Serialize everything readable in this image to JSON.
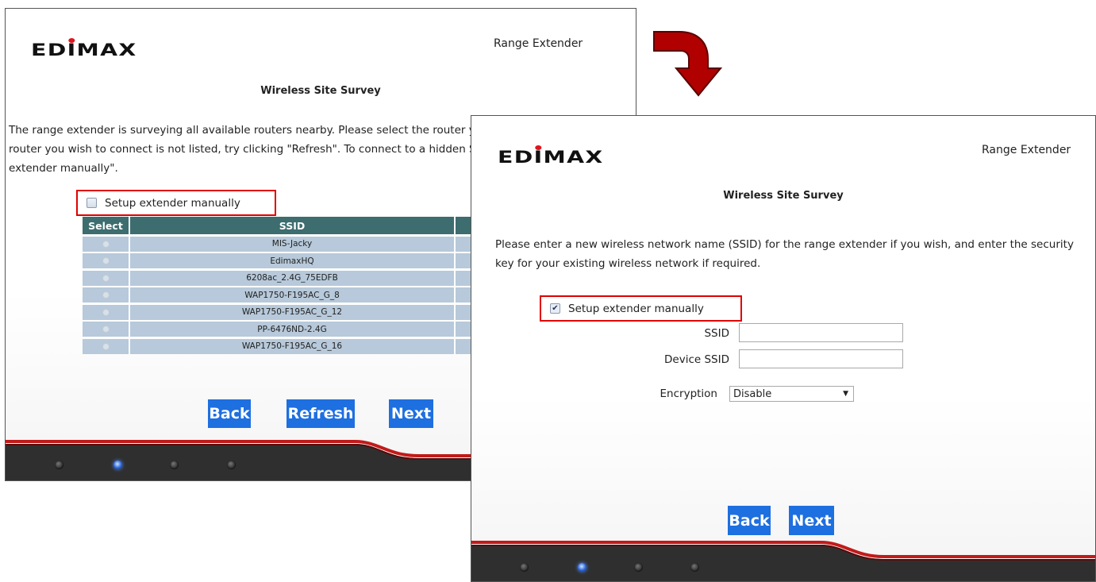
{
  "brand": {
    "logo": "EDIMAX",
    "product": "Range Extender"
  },
  "screen1": {
    "heading": "Wireless Site Survey",
    "intro_lines": [
      "The range extender is surveying all available routers nearby. Please select the router you",
      "router you wish to connect is not listed, try clicking \"Refresh\". To connect to a hidden SSI",
      "extender manually\"."
    ],
    "manual_label": "Setup extender manually",
    "manual_checked": false,
    "table": {
      "headers": [
        "Select",
        "SSID"
      ],
      "rows": [
        "MIS-Jacky",
        "EdimaxHQ",
        "6208ac_2.4G_75EDFB",
        "WAP1750-F195AC_G_8",
        "WAP1750-F195AC_G_12",
        "PP-6476ND-2.4G",
        "WAP1750-F195AC_G_16"
      ]
    },
    "buttons": {
      "back": "Back",
      "refresh": "Refresh",
      "next": "Next"
    }
  },
  "screen2": {
    "heading": "Wireless Site Survey",
    "intro_lines": [
      "Please enter a new wireless network name (SSID) for the range extender if you wish, and enter the security",
      "key for your existing wireless network if required."
    ],
    "manual_label": "Setup extender manually",
    "manual_checked": true,
    "fields": {
      "ssid_label": "SSID",
      "ssid_value": "",
      "device_ssid_label": "Device SSID",
      "device_ssid_value": "",
      "encryption_label": "Encryption",
      "encryption_value": "Disable"
    },
    "buttons": {
      "back": "Back",
      "next": "Next"
    }
  },
  "colors": {
    "header_teal": "#3d6d6f",
    "row_blue": "#b7c9da",
    "button_blue": "#1e6fe0",
    "highlight_red": "#e00000",
    "arrow_red": "#b00000"
  },
  "icons": [
    "edimax-logo",
    "red-curved-arrow-icon",
    "checkbox-icon",
    "radio-icon",
    "led-indicator-icon",
    "dropdown-arrow-icon"
  ]
}
